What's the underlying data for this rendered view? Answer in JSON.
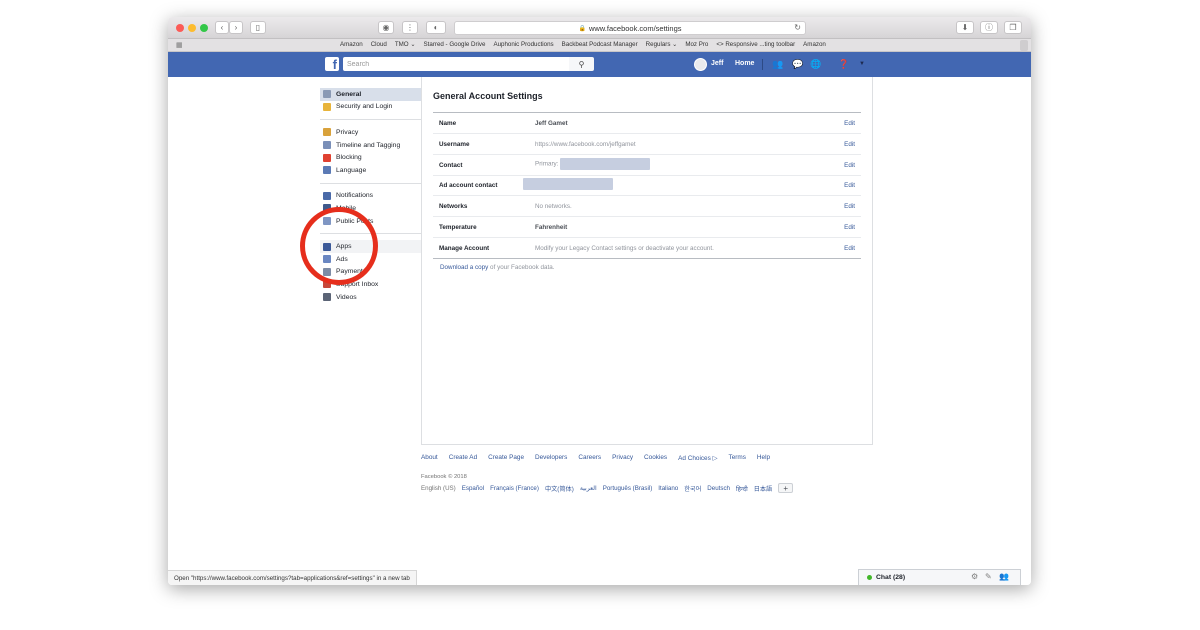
{
  "browser": {
    "url": "www.facebook.com/settings",
    "bookmarks": [
      "Amazon",
      "Cloud",
      "TMO ⌄",
      "Starred - Google Drive",
      "Auphonic Productions",
      "Backbeat Podcast Manager",
      "Regulars ⌄",
      "Moz Pro",
      "<> Responsive ...ting toolbar",
      "Amazon"
    ],
    "status_text": "Open \"https://www.facebook.com/settings?tab=applications&ref=settings\" in a new tab"
  },
  "header": {
    "logo": "f",
    "search_placeholder": "Search",
    "user_name": "Jeff",
    "home_label": "Home"
  },
  "sidebar": {
    "groups": [
      [
        {
          "label": "General",
          "icon": "gear-icon",
          "color": "#8a9ab5",
          "active": true
        },
        {
          "label": "Security and Login",
          "icon": "badge-icon",
          "color": "#e8b43b"
        }
      ],
      [
        {
          "label": "Privacy",
          "icon": "lock-icon",
          "color": "#d9a23b"
        },
        {
          "label": "Timeline and Tagging",
          "icon": "timeline-icon",
          "color": "#7a8fb8"
        },
        {
          "label": "Blocking",
          "icon": "block-icon",
          "color": "#e04131"
        },
        {
          "label": "Language",
          "icon": "language-icon",
          "color": "#5b7ab5"
        }
      ],
      [
        {
          "label": "Notifications",
          "icon": "globe-icon",
          "color": "#4a6aa8"
        },
        {
          "label": "Mobile",
          "icon": "mobile-icon",
          "color": "#3f5a8c"
        },
        {
          "label": "Public Posts",
          "icon": "rss-icon",
          "color": "#7f96c3"
        }
      ],
      [
        {
          "label": "Apps",
          "icon": "apps-icon",
          "color": "#3b5998",
          "highlight": true
        },
        {
          "label": "Ads",
          "icon": "ads-icon",
          "color": "#6a87c2"
        },
        {
          "label": "Payments",
          "icon": "card-icon",
          "color": "#7d8ca6"
        },
        {
          "label": "Support Inbox",
          "icon": "inbox-icon",
          "color": "#c7483a"
        },
        {
          "label": "Videos",
          "icon": "video-icon",
          "color": "#5b6476"
        }
      ]
    ]
  },
  "settings": {
    "title": "General Account Settings",
    "rows": [
      {
        "label": "Name",
        "value": "Jeff Gamet",
        "bold": true,
        "edit": "Edit"
      },
      {
        "label": "Username",
        "value": "https://www.facebook.com/jeffgamet",
        "edit": "Edit"
      },
      {
        "label": "Contact",
        "value": "Primary:",
        "blur": true,
        "edit": "Edit"
      },
      {
        "label": "Ad account contact",
        "value": "",
        "blur": true,
        "blur_offset": true,
        "edit": "Edit"
      },
      {
        "label": "Networks",
        "value": "No networks.",
        "edit": "Edit"
      },
      {
        "label": "Temperature",
        "value": "Fahrenheit",
        "bold": true,
        "edit": "Edit"
      },
      {
        "label": "Manage Account",
        "value": "Modify your Legacy Contact settings or deactivate your account.",
        "edit": "Edit"
      }
    ],
    "download_link": "Download a copy",
    "download_rest": " of your Facebook data."
  },
  "footer": {
    "links": [
      "About",
      "Create Ad",
      "Create Page",
      "Developers",
      "Careers",
      "Privacy",
      "Cookies",
      "Ad Choices ▷",
      "Terms",
      "Help"
    ],
    "copyright": "Facebook © 2018",
    "current_language": "English (US)",
    "languages": [
      "Español",
      "Français (France)",
      "中文(简体)",
      "العربية",
      "Português (Brasil)",
      "Italiano",
      "한국어",
      "Deutsch",
      "हिन्दी",
      "日本語"
    ],
    "plus": "+"
  },
  "chat": {
    "label": "Chat (28)"
  }
}
